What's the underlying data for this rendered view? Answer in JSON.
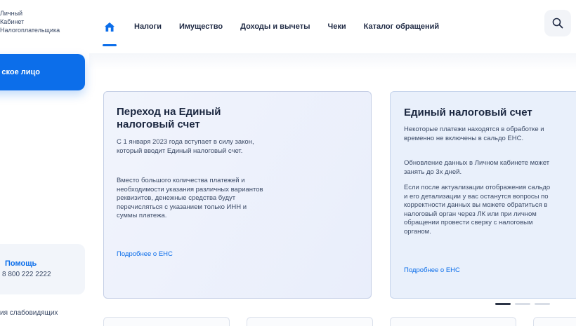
{
  "brand": {
    "lines": [
      "Личный",
      "Кабинет",
      "Налогоплательщика"
    ]
  },
  "nav": {
    "home_icon": "home-icon",
    "items": [
      {
        "label": "Налоги"
      },
      {
        "label": "Имущество"
      },
      {
        "label": "Доходы и вычеты"
      },
      {
        "label": "Чеки"
      },
      {
        "label": "Каталог обращений"
      }
    ],
    "search_icon": "search-icon"
  },
  "sidebar": {
    "profile_button": "ское лицо",
    "help": {
      "title": "Помощь",
      "phone": "8 800 222 2222",
      "icon": "help-icon"
    },
    "accessibility": "ия слабовидящих"
  },
  "cards": [
    {
      "title": "Переход на Единый налоговый счет",
      "paragraphs": [
        "С 1 января 2023 года вступает в силу закон, который вводит Единый налоговый счет.",
        "Вместо большого количества платежей и необходимости указания различных вариантов реквизитов, денежные средства будут перечисляться с указанием только ИНН и суммы платежа."
      ],
      "link": "Подробнее о ЕНС"
    },
    {
      "title": "Единый налоговый счет",
      "paragraphs": [
        "Некоторые платежи находятся в обработке и временно не включены в сальдо ЕНС.",
        "Обновление данных в Личном кабинете может занять до 3х дней.",
        "Если после актуализации отображения сальдо и его детализации у вас останутся вопросы по корректности данных вы можете обратиться в налоговый орган через ЛК или при личном обращении провести сверку с налоговым органом."
      ],
      "link": "Подробнее о ЕНС"
    }
  ],
  "carousel": {
    "slides": 3,
    "active": 1
  },
  "colors": {
    "accent": "#0c6eea",
    "text": "#1f2a44",
    "card_bg": "#e9eefb"
  }
}
